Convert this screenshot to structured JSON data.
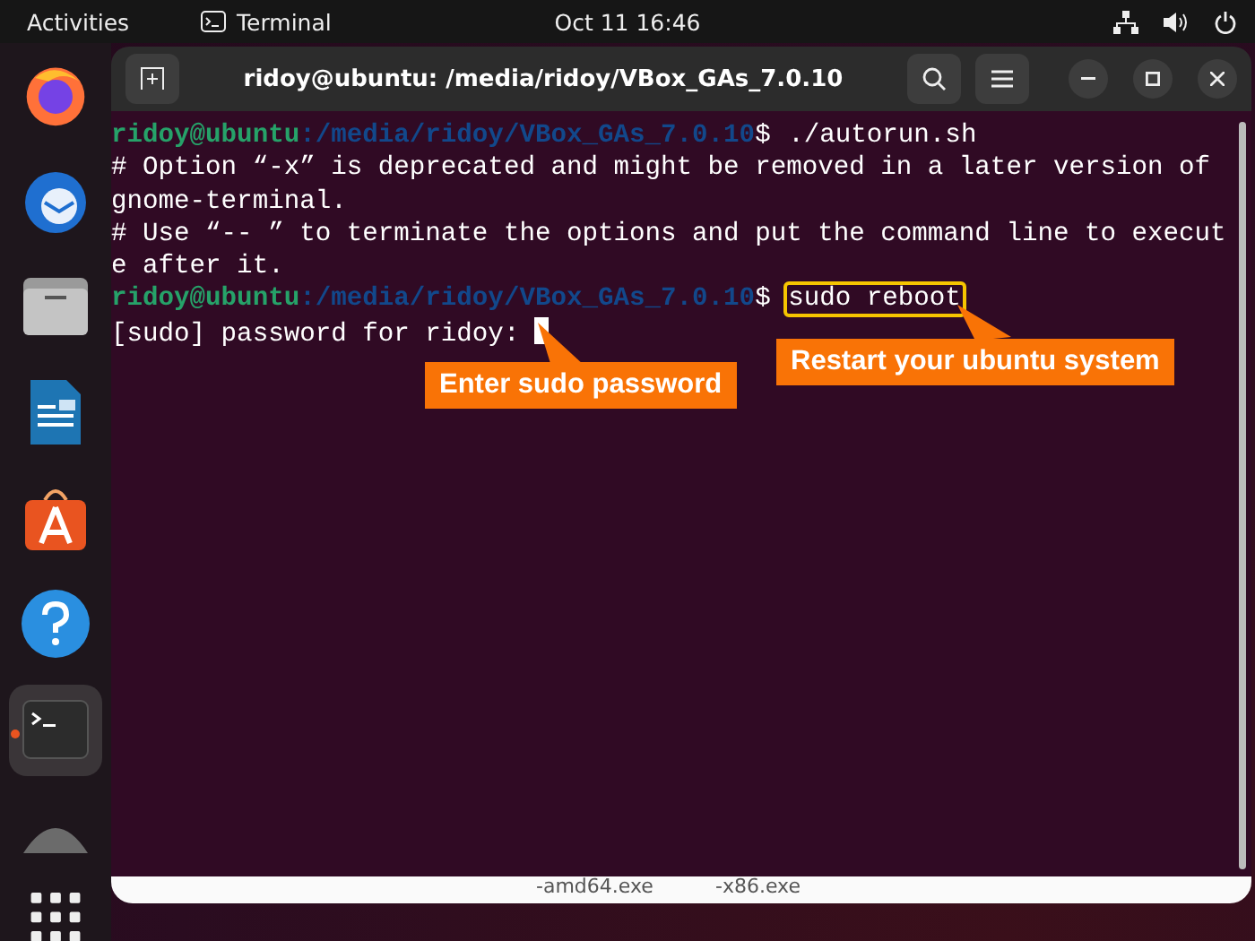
{
  "top_bar": {
    "activities": "Activities",
    "app_name": "Terminal",
    "clock": "Oct 11  16:46"
  },
  "dock": {
    "items": [
      {
        "kind": "firefox",
        "running": false
      },
      {
        "kind": "mail",
        "running": false
      },
      {
        "kind": "files",
        "running": false
      },
      {
        "kind": "writer",
        "running": false
      },
      {
        "kind": "store",
        "running": false
      },
      {
        "kind": "help",
        "running": false
      },
      {
        "kind": "terminal",
        "running": true
      },
      {
        "kind": "disk",
        "running": false
      }
    ]
  },
  "background_window": {
    "files": [
      "-amd64.exe",
      "-x86.exe"
    ]
  },
  "terminal": {
    "title": "ridoy@ubuntu: /media/ridoy/VBox_GAs_7.0.10",
    "lines": [
      {
        "kind": "prompt",
        "user": "ridoy@ubuntu",
        "path": ":/media/ridoy/VBox_GAs_7.0.10",
        "sign": "$",
        "command": "./autorun.sh",
        "highlighted": false
      },
      {
        "kind": "output",
        "text": "# Option “-x” is deprecated and might be removed in a later version of"
      },
      {
        "kind": "output",
        "text": "gnome-terminal."
      },
      {
        "kind": "output",
        "text": "# Use “-- ” to terminate the options and put the command line to execut"
      },
      {
        "kind": "output",
        "text": "e after it."
      },
      {
        "kind": "prompt",
        "user": "ridoy@ubuntu",
        "path": ":/media/ridoy/VBox_GAs_7.0.10",
        "sign": "$",
        "command": "sudo reboot",
        "highlighted": true
      },
      {
        "kind": "input",
        "text": "[sudo] password for ridoy:",
        "cursor": true
      }
    ]
  },
  "callouts": [
    {
      "text": "Enter sudo password"
    },
    {
      "text": "Restart your ubuntu system"
    }
  ]
}
